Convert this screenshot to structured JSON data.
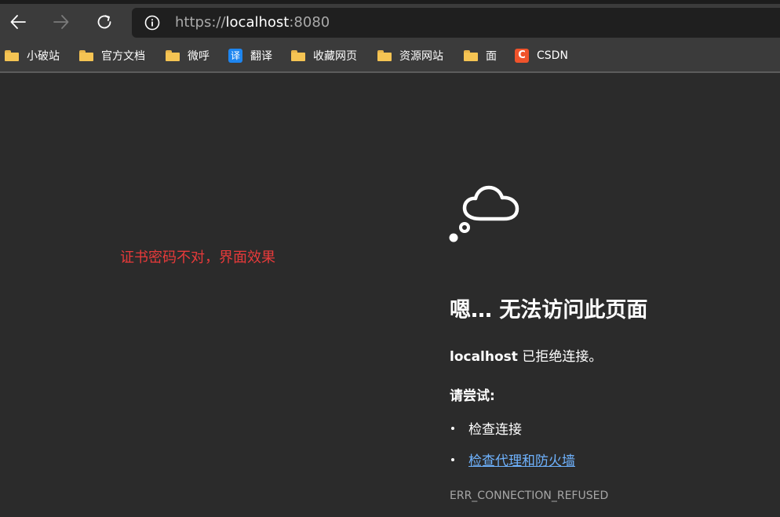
{
  "browser": {
    "address_bar": {
      "scheme": "https://",
      "host": "localhost",
      "port": ":8080"
    },
    "bookmarks": [
      {
        "label": "小破站",
        "icon": "folder-icon"
      },
      {
        "label": "官方文档",
        "icon": "folder-icon"
      },
      {
        "label": "微呼",
        "icon": "folder-icon"
      },
      {
        "label": "翻译",
        "icon": "translate-icon",
        "badge": "译"
      },
      {
        "label": "收藏网页",
        "icon": "folder-icon"
      },
      {
        "label": "资源网站",
        "icon": "folder-icon"
      },
      {
        "label": "面",
        "icon": "folder-icon"
      },
      {
        "label": "CSDN",
        "icon": "csdn-icon",
        "badge": "C"
      }
    ]
  },
  "annotation": "证书密码不对，界面效果",
  "error_page": {
    "icon": "thought-cloud-icon",
    "title": "嗯… 无法访问此页面",
    "host": "localhost",
    "desc_suffix": " 已拒绝连接。",
    "try_title": "请尝试:",
    "suggestions": [
      {
        "text": "检查连接",
        "is_link": false
      },
      {
        "text": "检查代理和防火墙",
        "is_link": true
      }
    ],
    "error_code": "ERR_CONNECTION_REFUSED"
  },
  "colors": {
    "page_bg": "#2b2b2b",
    "toolbar_bg": "#3b3b3b",
    "address_bg": "#1f1f1f",
    "annotation": "#e83a3a",
    "link": "#6fb3ff",
    "folder": "#f5c453"
  }
}
